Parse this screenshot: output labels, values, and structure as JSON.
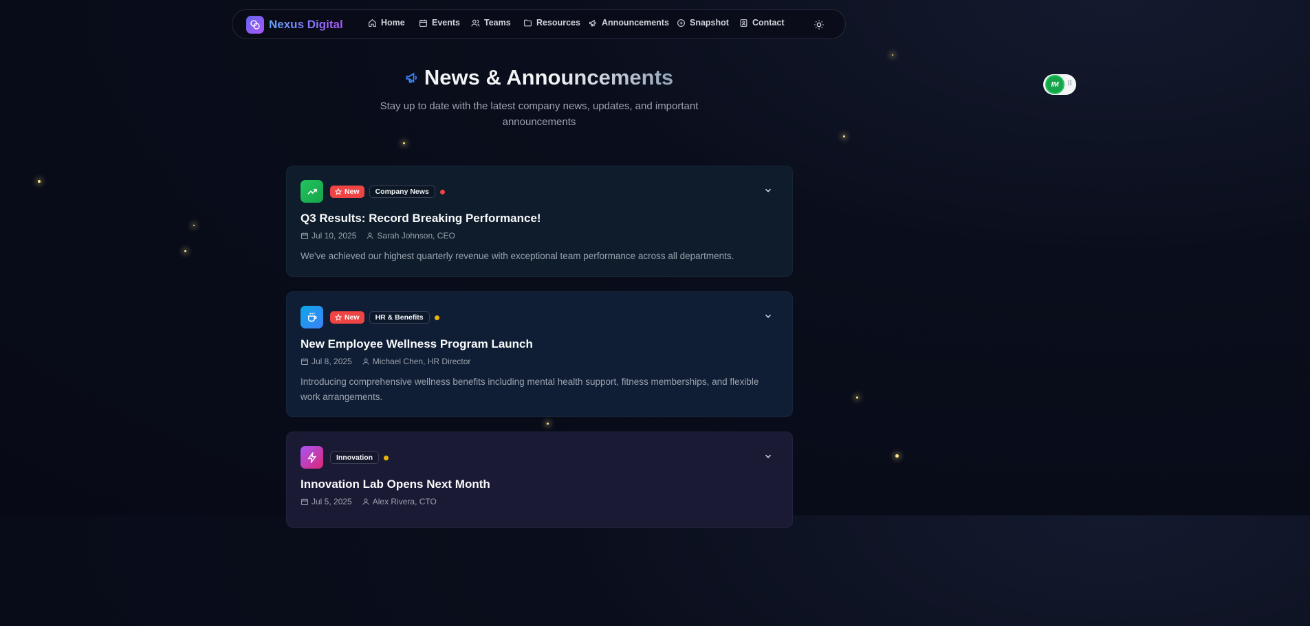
{
  "brand": {
    "name": "Nexus Digital"
  },
  "nav": {
    "items": [
      {
        "label": "Home",
        "icon": "home-icon"
      },
      {
        "label": "Events",
        "icon": "calendar-icon"
      },
      {
        "label": "Teams",
        "icon": "users-icon"
      },
      {
        "label": "Resources",
        "icon": "folder-icon"
      },
      {
        "label": "Announcements",
        "icon": "megaphone-icon"
      },
      {
        "label": "Snapshot",
        "icon": "snapshot-icon"
      },
      {
        "label": "Contact",
        "icon": "contact-icon"
      }
    ],
    "theme_toggle_icon": "sun-icon"
  },
  "header": {
    "title": "News & Announcements",
    "subtitle": "Stay up to date with the latest company news, updates, and important announcements"
  },
  "announcements": [
    {
      "new_label": "New",
      "category": "Company News",
      "icon": "trending-up-icon",
      "icon_color": "#22c55e",
      "dot_color": "#ef4444",
      "title": "Q3 Results: Record Breaking Performance!",
      "date": "Jul 10, 2025",
      "author": "Sarah Johnson, CEO",
      "description": "We've achieved our highest quarterly revenue with exceptional team performance across all departments."
    },
    {
      "new_label": "New",
      "category": "HR & Benefits",
      "icon": "coffee-icon",
      "icon_color": "#0ea5e9",
      "dot_color": "#eab308",
      "title": "New Employee Wellness Program Launch",
      "date": "Jul 8, 2025",
      "author": "Michael Chen, HR Director",
      "description": "Introducing comprehensive wellness benefits including mental health support, fitness memberships, and flexible work arrangements."
    },
    {
      "category": "Innovation",
      "icon": "lightning-icon",
      "icon_color": "#c026d3",
      "dot_color": "#eab308",
      "title": "Innovation Lab Opens Next Month",
      "date": "Jul 5, 2025",
      "author": "Alex Rivera, CTO"
    }
  ],
  "widget": {
    "label": "IM"
  }
}
